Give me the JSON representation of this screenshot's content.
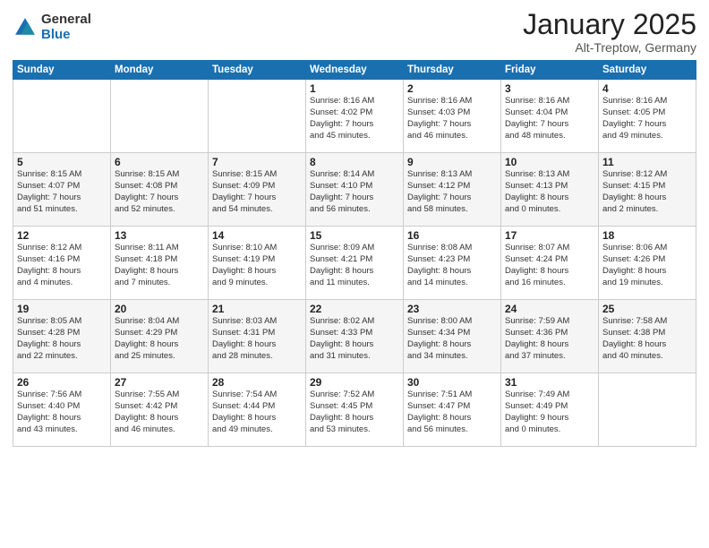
{
  "header": {
    "logo_general": "General",
    "logo_blue": "Blue",
    "title": "January 2025",
    "location": "Alt-Treptow, Germany"
  },
  "weekdays": [
    "Sunday",
    "Monday",
    "Tuesday",
    "Wednesday",
    "Thursday",
    "Friday",
    "Saturday"
  ],
  "weeks": [
    [
      {
        "day": "",
        "info": ""
      },
      {
        "day": "",
        "info": ""
      },
      {
        "day": "",
        "info": ""
      },
      {
        "day": "1",
        "info": "Sunrise: 8:16 AM\nSunset: 4:02 PM\nDaylight: 7 hours\nand 45 minutes."
      },
      {
        "day": "2",
        "info": "Sunrise: 8:16 AM\nSunset: 4:03 PM\nDaylight: 7 hours\nand 46 minutes."
      },
      {
        "day": "3",
        "info": "Sunrise: 8:16 AM\nSunset: 4:04 PM\nDaylight: 7 hours\nand 48 minutes."
      },
      {
        "day": "4",
        "info": "Sunrise: 8:16 AM\nSunset: 4:05 PM\nDaylight: 7 hours\nand 49 minutes."
      }
    ],
    [
      {
        "day": "5",
        "info": "Sunrise: 8:15 AM\nSunset: 4:07 PM\nDaylight: 7 hours\nand 51 minutes."
      },
      {
        "day": "6",
        "info": "Sunrise: 8:15 AM\nSunset: 4:08 PM\nDaylight: 7 hours\nand 52 minutes."
      },
      {
        "day": "7",
        "info": "Sunrise: 8:15 AM\nSunset: 4:09 PM\nDaylight: 7 hours\nand 54 minutes."
      },
      {
        "day": "8",
        "info": "Sunrise: 8:14 AM\nSunset: 4:10 PM\nDaylight: 7 hours\nand 56 minutes."
      },
      {
        "day": "9",
        "info": "Sunrise: 8:13 AM\nSunset: 4:12 PM\nDaylight: 7 hours\nand 58 minutes."
      },
      {
        "day": "10",
        "info": "Sunrise: 8:13 AM\nSunset: 4:13 PM\nDaylight: 8 hours\nand 0 minutes."
      },
      {
        "day": "11",
        "info": "Sunrise: 8:12 AM\nSunset: 4:15 PM\nDaylight: 8 hours\nand 2 minutes."
      }
    ],
    [
      {
        "day": "12",
        "info": "Sunrise: 8:12 AM\nSunset: 4:16 PM\nDaylight: 8 hours\nand 4 minutes."
      },
      {
        "day": "13",
        "info": "Sunrise: 8:11 AM\nSunset: 4:18 PM\nDaylight: 8 hours\nand 7 minutes."
      },
      {
        "day": "14",
        "info": "Sunrise: 8:10 AM\nSunset: 4:19 PM\nDaylight: 8 hours\nand 9 minutes."
      },
      {
        "day": "15",
        "info": "Sunrise: 8:09 AM\nSunset: 4:21 PM\nDaylight: 8 hours\nand 11 minutes."
      },
      {
        "day": "16",
        "info": "Sunrise: 8:08 AM\nSunset: 4:23 PM\nDaylight: 8 hours\nand 14 minutes."
      },
      {
        "day": "17",
        "info": "Sunrise: 8:07 AM\nSunset: 4:24 PM\nDaylight: 8 hours\nand 16 minutes."
      },
      {
        "day": "18",
        "info": "Sunrise: 8:06 AM\nSunset: 4:26 PM\nDaylight: 8 hours\nand 19 minutes."
      }
    ],
    [
      {
        "day": "19",
        "info": "Sunrise: 8:05 AM\nSunset: 4:28 PM\nDaylight: 8 hours\nand 22 minutes."
      },
      {
        "day": "20",
        "info": "Sunrise: 8:04 AM\nSunset: 4:29 PM\nDaylight: 8 hours\nand 25 minutes."
      },
      {
        "day": "21",
        "info": "Sunrise: 8:03 AM\nSunset: 4:31 PM\nDaylight: 8 hours\nand 28 minutes."
      },
      {
        "day": "22",
        "info": "Sunrise: 8:02 AM\nSunset: 4:33 PM\nDaylight: 8 hours\nand 31 minutes."
      },
      {
        "day": "23",
        "info": "Sunrise: 8:00 AM\nSunset: 4:34 PM\nDaylight: 8 hours\nand 34 minutes."
      },
      {
        "day": "24",
        "info": "Sunrise: 7:59 AM\nSunset: 4:36 PM\nDaylight: 8 hours\nand 37 minutes."
      },
      {
        "day": "25",
        "info": "Sunrise: 7:58 AM\nSunset: 4:38 PM\nDaylight: 8 hours\nand 40 minutes."
      }
    ],
    [
      {
        "day": "26",
        "info": "Sunrise: 7:56 AM\nSunset: 4:40 PM\nDaylight: 8 hours\nand 43 minutes."
      },
      {
        "day": "27",
        "info": "Sunrise: 7:55 AM\nSunset: 4:42 PM\nDaylight: 8 hours\nand 46 minutes."
      },
      {
        "day": "28",
        "info": "Sunrise: 7:54 AM\nSunset: 4:44 PM\nDaylight: 8 hours\nand 49 minutes."
      },
      {
        "day": "29",
        "info": "Sunrise: 7:52 AM\nSunset: 4:45 PM\nDaylight: 8 hours\nand 53 minutes."
      },
      {
        "day": "30",
        "info": "Sunrise: 7:51 AM\nSunset: 4:47 PM\nDaylight: 8 hours\nand 56 minutes."
      },
      {
        "day": "31",
        "info": "Sunrise: 7:49 AM\nSunset: 4:49 PM\nDaylight: 9 hours\nand 0 minutes."
      },
      {
        "day": "",
        "info": ""
      }
    ]
  ]
}
